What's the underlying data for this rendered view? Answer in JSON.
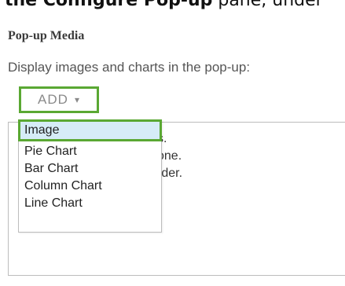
{
  "banner": {
    "pre": "...",
    "bold": "the Configure Pop-up",
    "post": " pane, under"
  },
  "section_title": "Pop-up Media",
  "description": "Display images and charts in the pop-up:",
  "add_button": {
    "label": "ADD",
    "icon": "chevron-down-icon"
  },
  "behind_text": [
    "s.",
    "one.",
    "rder."
  ],
  "menu": {
    "items": [
      "Image",
      "Pie Chart",
      "Bar Chart",
      "Column Chart",
      "Line Chart"
    ],
    "selected": "Image"
  },
  "colors": {
    "highlight_border": "#5aa833",
    "selected_bg": "#d6ecf7"
  }
}
